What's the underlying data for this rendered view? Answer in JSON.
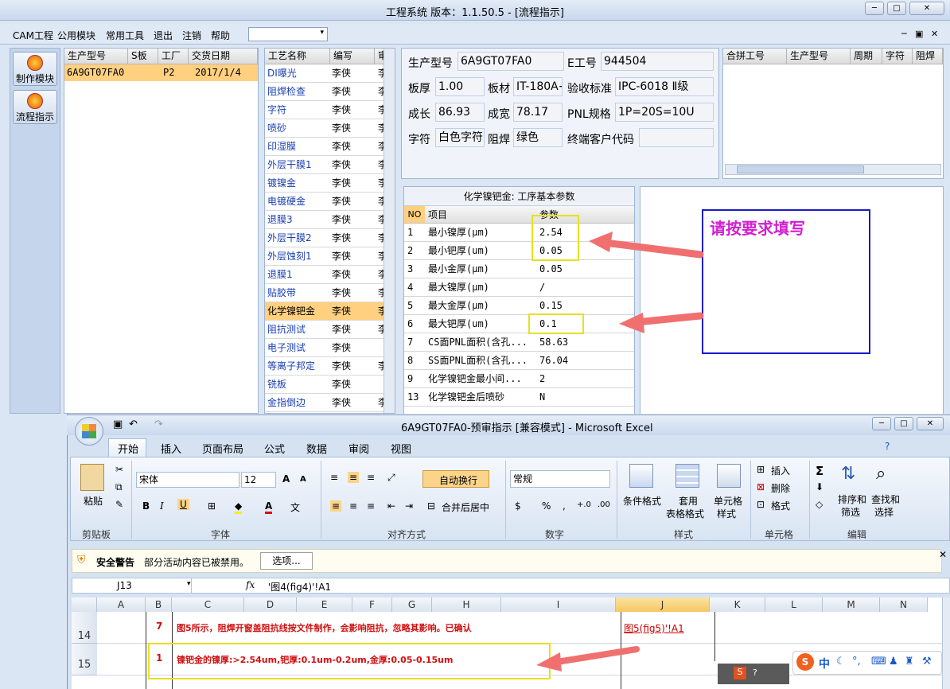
{
  "window": {
    "title": "工程系统  版本：1.1.50.5 - [流程指示]",
    "min": "─",
    "max": "□",
    "close": "✕"
  },
  "menu": [
    "CAM工程",
    "公用模块",
    "常用工具",
    "退出",
    "注销",
    "帮助"
  ],
  "menu_dropdown": "▾",
  "mdi_controls": [
    "─",
    "▣",
    "✕"
  ],
  "left_buttons": [
    "制作模块",
    "流程指示"
  ],
  "product_grid": {
    "headers": [
      "生产型号",
      "S板",
      "工厂",
      "交货日期"
    ],
    "rows": [
      [
        "6A9GT07FA0",
        "",
        "P2",
        "2017/1/4"
      ]
    ]
  },
  "process_grid": {
    "headers": [
      "工艺名称",
      "编写",
      "审"
    ],
    "rows": [
      [
        "DI曝光",
        "李侠",
        "李"
      ],
      [
        "阻焊检查",
        "李侠",
        "李"
      ],
      [
        "字符",
        "李侠",
        "李"
      ],
      [
        "喷砂",
        "李侠",
        "李"
      ],
      [
        "印湿膜",
        "李侠",
        "李"
      ],
      [
        "外层干膜1",
        "李侠",
        "李"
      ],
      [
        "镀镍金",
        "李侠",
        "李"
      ],
      [
        "电镀硬金",
        "李侠",
        "李"
      ],
      [
        "退膜3",
        "李侠",
        "李"
      ],
      [
        "外层干膜2",
        "李侠",
        "李"
      ],
      [
        "外层蚀刻1",
        "李侠",
        "李"
      ],
      [
        "退膜1",
        "李侠",
        "李"
      ],
      [
        "贴胶带",
        "李侠",
        "李"
      ],
      [
        "化学镍钯金",
        "李侠",
        "李"
      ],
      [
        "阻抗测试",
        "李侠",
        "李"
      ],
      [
        "电子测试",
        "李侠",
        ""
      ],
      [
        "等离子邦定",
        "李侠",
        "李"
      ],
      [
        "铣板",
        "李侠",
        ""
      ],
      [
        "金指倒边",
        "李侠",
        "李"
      ]
    ]
  },
  "info": {
    "prod_label": "生产型号",
    "prod": "6A9GT07FA0",
    "eng_label": "E工号",
    "eng": "944504",
    "thick_label": "板厚",
    "thick": "1.00",
    "mat_label": "板材",
    "mat": "IT-180A+",
    "std_label": "验收标准",
    "std": "IPC-6018 Ⅱ级",
    "len_label": "成长",
    "len": "86.93",
    "wid_label": "成宽",
    "wid": "78.17",
    "pnl_label": "PNL规格",
    "pnl": "1P=20S=10U",
    "char_label": "字符",
    "char": "白色字符",
    "mask_label": "阻焊",
    "mask": "绿色",
    "cust_label": "终端客户代码",
    "cust": ""
  },
  "combine_grid": {
    "headers": [
      "合拼工号",
      "生产型号",
      "周期",
      "字符",
      "阻焊"
    ]
  },
  "params": {
    "title": "化学镍钯金: 工序基本参数",
    "headers": [
      "NO",
      "项目",
      "参数"
    ],
    "rows": [
      [
        "1",
        "最小镍厚(μm)",
        "2.54"
      ],
      [
        "2",
        "最小钯厚(um)",
        "0.05"
      ],
      [
        "3",
        "最小金厚(μm)",
        "0.05"
      ],
      [
        "4",
        "最大镍厚(μm)",
        "/"
      ],
      [
        "5",
        "最大金厚(μm)",
        "0.15"
      ],
      [
        "6",
        "最大钯厚(um)",
        "0.1"
      ],
      [
        "7",
        "CS面PNL面积(含孔...",
        "58.63"
      ],
      [
        "8",
        "SS面PNL面积(含孔...",
        "76.04"
      ],
      [
        "9",
        "化学镍钯金最小间...",
        "2"
      ],
      [
        "13",
        "化学镍钯金后喷砂",
        "N"
      ]
    ]
  },
  "annotation": "请按要求填写",
  "excel": {
    "title": "6A9GT07FA0-预审指示 [兼容模式] - Microsoft Excel",
    "tabs": [
      "开始",
      "插入",
      "页面布局",
      "公式",
      "数据",
      "审阅",
      "视图"
    ],
    "paste": "粘贴",
    "clipboard": "剪贴板",
    "font_name": "宋体",
    "font_size": "12",
    "font_group": "字体",
    "wrap": "自动换行",
    "merge": "合并后居中",
    "align_group": "对齐方式",
    "numfmt": "常规",
    "num_group": "数字",
    "cond": "条件格式",
    "table_fmt_1": "套用",
    "table_fmt_2": "表格格式",
    "cell_style_1": "单元格",
    "cell_style_2": "样式",
    "style_group": "样式",
    "insert": "插入",
    "delete": "删除",
    "format": "格式",
    "cells_group": "单元格",
    "sort_1": "排序和",
    "sort_2": "筛选",
    "find_1": "查找和",
    "find_2": "选择",
    "edit_group": "编辑",
    "security_title": "安全警告",
    "security_msg": "部分活动内容已被禁用。",
    "options": "选项...",
    "namebox": "J13",
    "fx": "fx",
    "formula": "'图4(fig4)'!A1",
    "columns": [
      "A",
      "B",
      "C",
      "D",
      "E",
      "F",
      "G",
      "H",
      "I",
      "J",
      "K",
      "L",
      "M",
      "N"
    ],
    "row14": {
      "num": "14",
      "b": "7",
      "c": "图5所示，阻焊开窗盖阻抗线按文件制作，会影响阻抗，忽略其影响。已确认",
      "j": "图5(fig5)'!A1"
    },
    "row15": {
      "num": "15",
      "b": "1",
      "c": "镍钯金的镍厚:>2.54um,钯厚:0.1um-0.2um,金厚:0.05-0.15um"
    }
  },
  "ime": "中"
}
